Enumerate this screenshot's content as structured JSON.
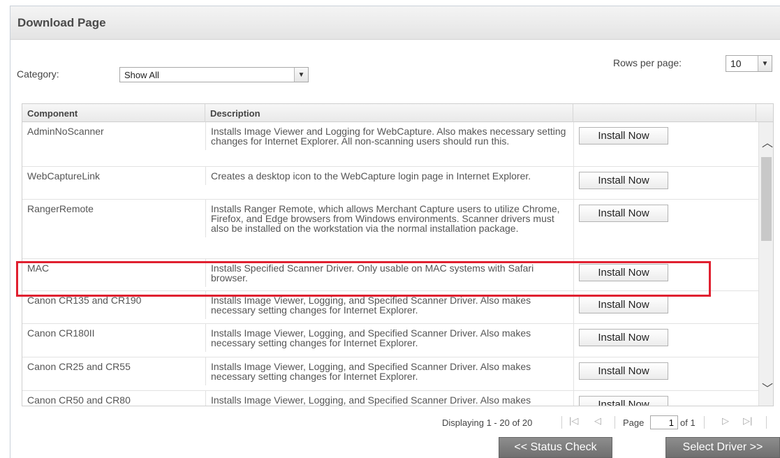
{
  "panel": {
    "title": "Download Page"
  },
  "rows_per_page": {
    "label": "Rows per page:",
    "value": "10"
  },
  "category": {
    "label": "Category:",
    "value": "Show All"
  },
  "grid": {
    "headers": [
      "Component",
      "Description",
      ""
    ],
    "install_label": "Install Now",
    "rows": [
      {
        "component": "AdminNoScanner",
        "description": "Installs Image Viewer and Logging for WebCapture. Also makes necessary setting changes for Internet Explorer. All non-scanning users should run this."
      },
      {
        "component": "WebCaptureLink",
        "description": "Creates a desktop icon to the WebCapture login page in Internet Explorer."
      },
      {
        "component": "RangerRemote",
        "description": "Installs Ranger Remote, which allows Merchant Capture users to utilize Chrome, Firefox, and Edge browsers from Windows environments. Scanner drivers must also be installed on the workstation via the normal installation package."
      },
      {
        "component": "MAC",
        "description": "Installs Specified Scanner Driver. Only usable on MAC systems with Safari browser."
      },
      {
        "component": "Canon CR135 and CR190",
        "description": "Installs Image Viewer, Logging, and Specified Scanner Driver. Also makes necessary setting changes for Internet Explorer."
      },
      {
        "component": "Canon CR180II",
        "description": "Installs Image Viewer, Logging, and Specified Scanner Driver. Also makes necessary setting changes for Internet Explorer."
      },
      {
        "component": "Canon CR25 and CR55",
        "description": "Installs Image Viewer, Logging, and Specified Scanner Driver. Also makes necessary setting changes for Internet Explorer."
      },
      {
        "component": "Canon CR50 and CR80",
        "description": "Installs Image Viewer, Logging, and Specified Scanner Driver. Also makes necessary setting changes for Internet Explorer."
      }
    ]
  },
  "pager": {
    "displaying": "Displaying 1 - 20 of 20",
    "page_label": "Page",
    "page_value": "1",
    "of_label": "of 1"
  },
  "buttons": {
    "status_check": "<< Status Check",
    "select_driver": "Select Driver >>"
  },
  "colors": {
    "highlight": "#e02030",
    "button_gray": "#7a7a7a"
  }
}
